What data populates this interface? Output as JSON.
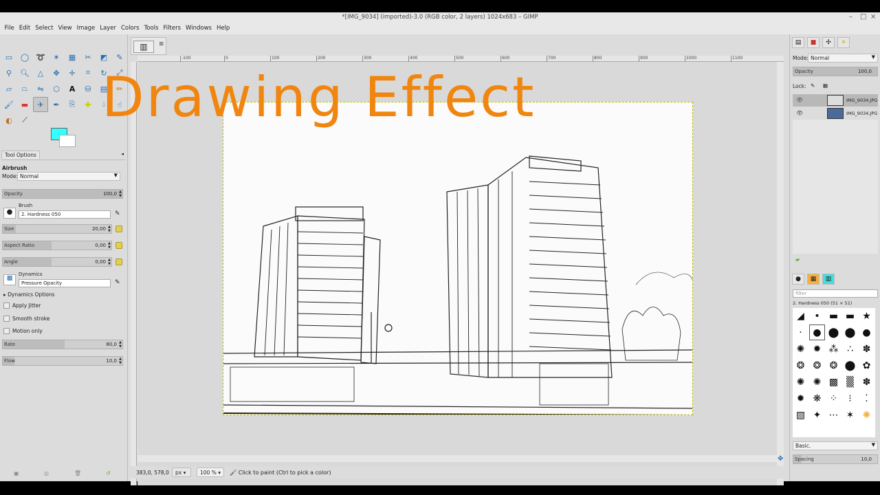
{
  "window": {
    "title": "*[IMG_9034] (imported)-3.0 (RGB color, 2 layers) 1024x683 – GIMP"
  },
  "menu": [
    "File",
    "Edit",
    "Select",
    "View",
    "Image",
    "Layer",
    "Colors",
    "Tools",
    "Filters",
    "Windows",
    "Help"
  ],
  "overlay": {
    "text": "Drawing Effect",
    "color": "#f0860f"
  },
  "colors": {
    "foreground": "#33ffff",
    "background": "#ffffff"
  },
  "tool_options": {
    "tab": "Tool Options",
    "tool": "Airbrush",
    "mode_label": "Mode:",
    "mode_value": "Normal",
    "opacity_label": "Opacity",
    "opacity_value": "100,0",
    "brush_label": "Brush",
    "brush_value": "2. Hardness 050",
    "size_label": "Size",
    "size_value": "20,00",
    "aspect_label": "Aspect Ratio",
    "aspect_value": "0,00",
    "angle_label": "Angle",
    "angle_value": "0,00",
    "dynamics_label": "Dynamics",
    "dynamics_value": "Pressure Opacity",
    "dynamics_options": "Dynamics Options",
    "apply_jitter": "Apply Jitter",
    "smooth_stroke": "Smooth stroke",
    "motion_only": "Motion only",
    "rate_label": "Rate",
    "rate_value": "80,0",
    "flow_label": "Flow",
    "flow_value": "10,0"
  },
  "ruler": [
    "-100",
    "0",
    "100",
    "200",
    "300",
    "400",
    "500",
    "600",
    "700",
    "800",
    "900",
    "1000",
    "1100"
  ],
  "status": {
    "coords": "383,0, 578,0",
    "unit": "px",
    "zoom": "100 %",
    "message": "Click to paint (Ctrl to pick a color)"
  },
  "layers": {
    "mode_label": "Mode:",
    "mode_value": "Normal",
    "opacity_label": "Opacity",
    "opacity_value": "100,0",
    "lock_label": "Lock:",
    "items": [
      {
        "name": "IMG_9034.JPG"
      },
      {
        "name": "IMG_9034.JPG"
      }
    ]
  },
  "brushes": {
    "filter_placeholder": "filter",
    "current": "2. Hardness 050 (51 × 51)",
    "preset": "Basic.",
    "spacing_label": "Spacing",
    "spacing_value": "10,0"
  }
}
